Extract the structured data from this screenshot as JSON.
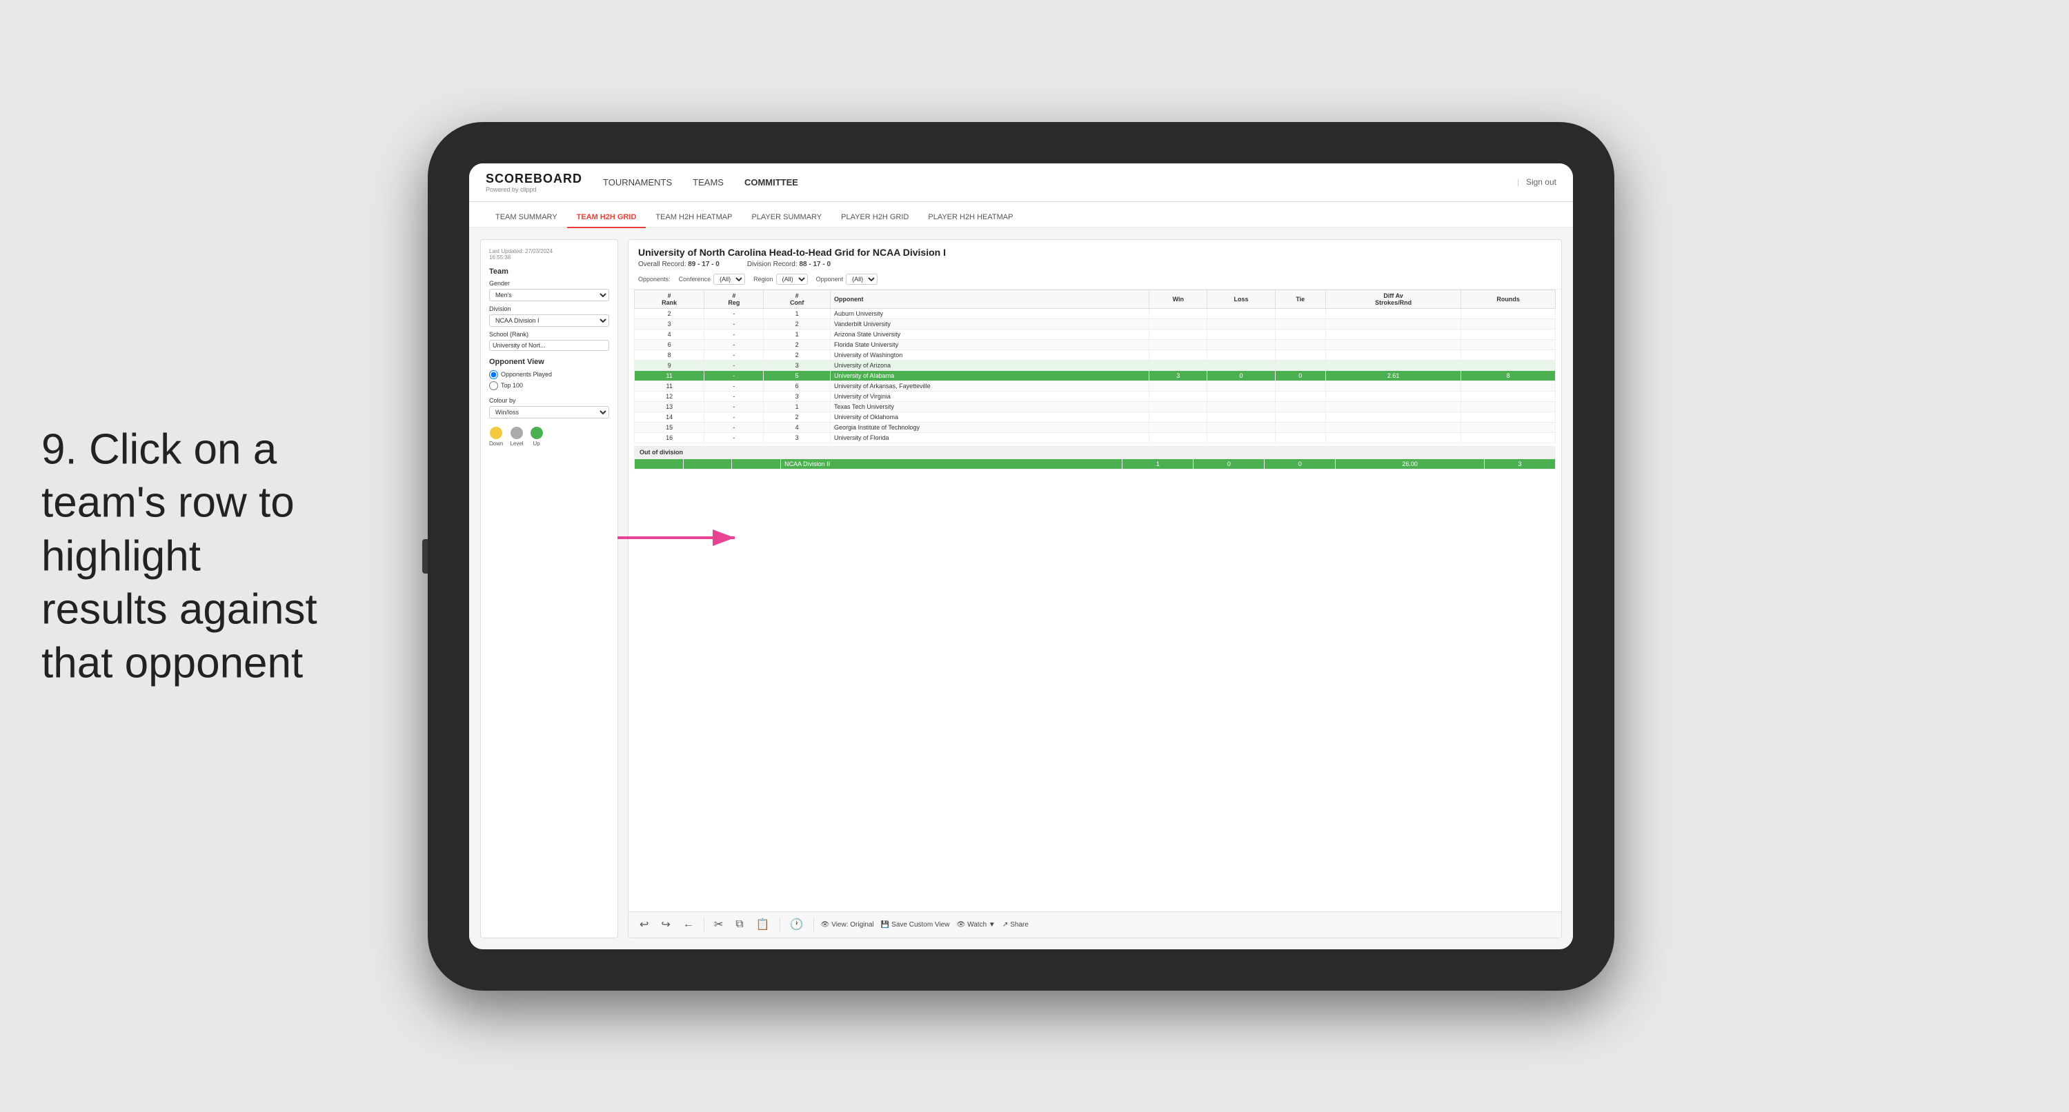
{
  "instruction": {
    "step": "9.",
    "text": "Click on a team's row to highlight results against that opponent"
  },
  "nav": {
    "logo": "SCOREBOARD",
    "logo_sub": "Powered by clippd",
    "links": [
      "TOURNAMENTS",
      "TEAMS",
      "COMMITTEE"
    ],
    "sign_out": "Sign out"
  },
  "sub_tabs": [
    "TEAM SUMMARY",
    "TEAM H2H GRID",
    "TEAM H2H HEATMAP",
    "PLAYER SUMMARY",
    "PLAYER H2H GRID",
    "PLAYER H2H HEATMAP"
  ],
  "active_sub_tab": "TEAM H2H GRID",
  "left_panel": {
    "last_updated_label": "Last Updated: 27/03/2024",
    "last_updated_time": "16:55:38",
    "team_label": "Team",
    "gender_label": "Gender",
    "gender_value": "Men's",
    "division_label": "Division",
    "division_value": "NCAA Division I",
    "school_rank_label": "School (Rank)",
    "school_rank_value": "University of Nort...",
    "opponent_view_label": "Opponent View",
    "opponents_played": "Opponents Played",
    "top100": "Top 100",
    "colour_by_label": "Colour by",
    "colour_by_value": "Win/loss",
    "legend": [
      {
        "label": "Down",
        "color": "#f5c842"
      },
      {
        "label": "Level",
        "color": "#aaaaaa"
      },
      {
        "label": "Up",
        "color": "#4caf50"
      }
    ]
  },
  "grid": {
    "title": "University of North Carolina Head-to-Head Grid for NCAA Division I",
    "overall_record_label": "Overall Record:",
    "overall_record": "89 - 17 - 0",
    "division_record_label": "Division Record:",
    "division_record": "88 - 17 - 0",
    "filters": {
      "opponents_label": "Opponents:",
      "conference_label": "Conference",
      "conference_value": "(All)",
      "region_label": "Region",
      "region_value": "(All)",
      "opponent_label": "Opponent",
      "opponent_value": "(All)"
    },
    "columns": [
      "#\nRank",
      "#\nReg",
      "#\nConf",
      "Opponent",
      "Win",
      "Loss",
      "Tie",
      "Diff Av\nStrokes/Rnd",
      "Rounds"
    ],
    "rows": [
      {
        "rank": "2",
        "reg": "-",
        "conf": "1",
        "opponent": "Auburn University",
        "win": "",
        "loss": "",
        "tie": "",
        "diff": "",
        "rounds": "",
        "highlight": false,
        "color": "light"
      },
      {
        "rank": "3",
        "reg": "-",
        "conf": "2",
        "opponent": "Vanderbilt University",
        "win": "",
        "loss": "",
        "tie": "",
        "diff": "",
        "rounds": "",
        "highlight": false,
        "color": "light"
      },
      {
        "rank": "4",
        "reg": "-",
        "conf": "1",
        "opponent": "Arizona State University",
        "win": "",
        "loss": "",
        "tie": "",
        "diff": "",
        "rounds": "",
        "highlight": false,
        "color": "light"
      },
      {
        "rank": "6",
        "reg": "-",
        "conf": "2",
        "opponent": "Florida State University",
        "win": "",
        "loss": "",
        "tie": "",
        "diff": "",
        "rounds": "",
        "highlight": false,
        "color": "light"
      },
      {
        "rank": "8",
        "reg": "-",
        "conf": "2",
        "opponent": "University of Washington",
        "win": "",
        "loss": "",
        "tie": "",
        "diff": "",
        "rounds": "",
        "highlight": false,
        "color": "light"
      },
      {
        "rank": "9",
        "reg": "-",
        "conf": "3",
        "opponent": "University of Arizona",
        "win": "",
        "loss": "",
        "tie": "",
        "diff": "",
        "rounds": "",
        "highlight": false,
        "color": "med"
      },
      {
        "rank": "11",
        "reg": "-",
        "conf": "5",
        "opponent": "University of Alabama",
        "win": "3",
        "loss": "0",
        "tie": "0",
        "diff": "2.61",
        "rounds": "8",
        "highlight": true,
        "color": "green"
      },
      {
        "rank": "11",
        "reg": "-",
        "conf": "6",
        "opponent": "University of Arkansas, Fayetteville",
        "win": "",
        "loss": "",
        "tie": "",
        "diff": "",
        "rounds": "",
        "highlight": false,
        "color": "light"
      },
      {
        "rank": "12",
        "reg": "-",
        "conf": "3",
        "opponent": "University of Virginia",
        "win": "",
        "loss": "",
        "tie": "",
        "diff": "",
        "rounds": "",
        "highlight": false,
        "color": "light"
      },
      {
        "rank": "13",
        "reg": "-",
        "conf": "1",
        "opponent": "Texas Tech University",
        "win": "",
        "loss": "",
        "tie": "",
        "diff": "",
        "rounds": "",
        "highlight": false,
        "color": "light"
      },
      {
        "rank": "14",
        "reg": "-",
        "conf": "2",
        "opponent": "University of Oklahoma",
        "win": "",
        "loss": "",
        "tie": "",
        "diff": "",
        "rounds": "",
        "highlight": false,
        "color": "light"
      },
      {
        "rank": "15",
        "reg": "-",
        "conf": "4",
        "opponent": "Georgia Institute of Technology",
        "win": "",
        "loss": "",
        "tie": "",
        "diff": "",
        "rounds": "",
        "highlight": false,
        "color": "light"
      },
      {
        "rank": "16",
        "reg": "-",
        "conf": "3",
        "opponent": "University of Florida",
        "win": "",
        "loss": "",
        "tie": "",
        "diff": "",
        "rounds": "",
        "highlight": false,
        "color": "light"
      }
    ],
    "out_of_division_label": "Out of division",
    "out_of_division_row": {
      "label": "NCAA Division II",
      "win": "1",
      "loss": "0",
      "tie": "0",
      "diff": "26.00",
      "rounds": "3",
      "highlight": true
    }
  },
  "toolbar": {
    "undo": "↩",
    "redo": "↪",
    "back": "←",
    "view_original": "View: Original",
    "save_custom": "Save Custom View",
    "watch": "Watch ▼",
    "share": "Share"
  }
}
